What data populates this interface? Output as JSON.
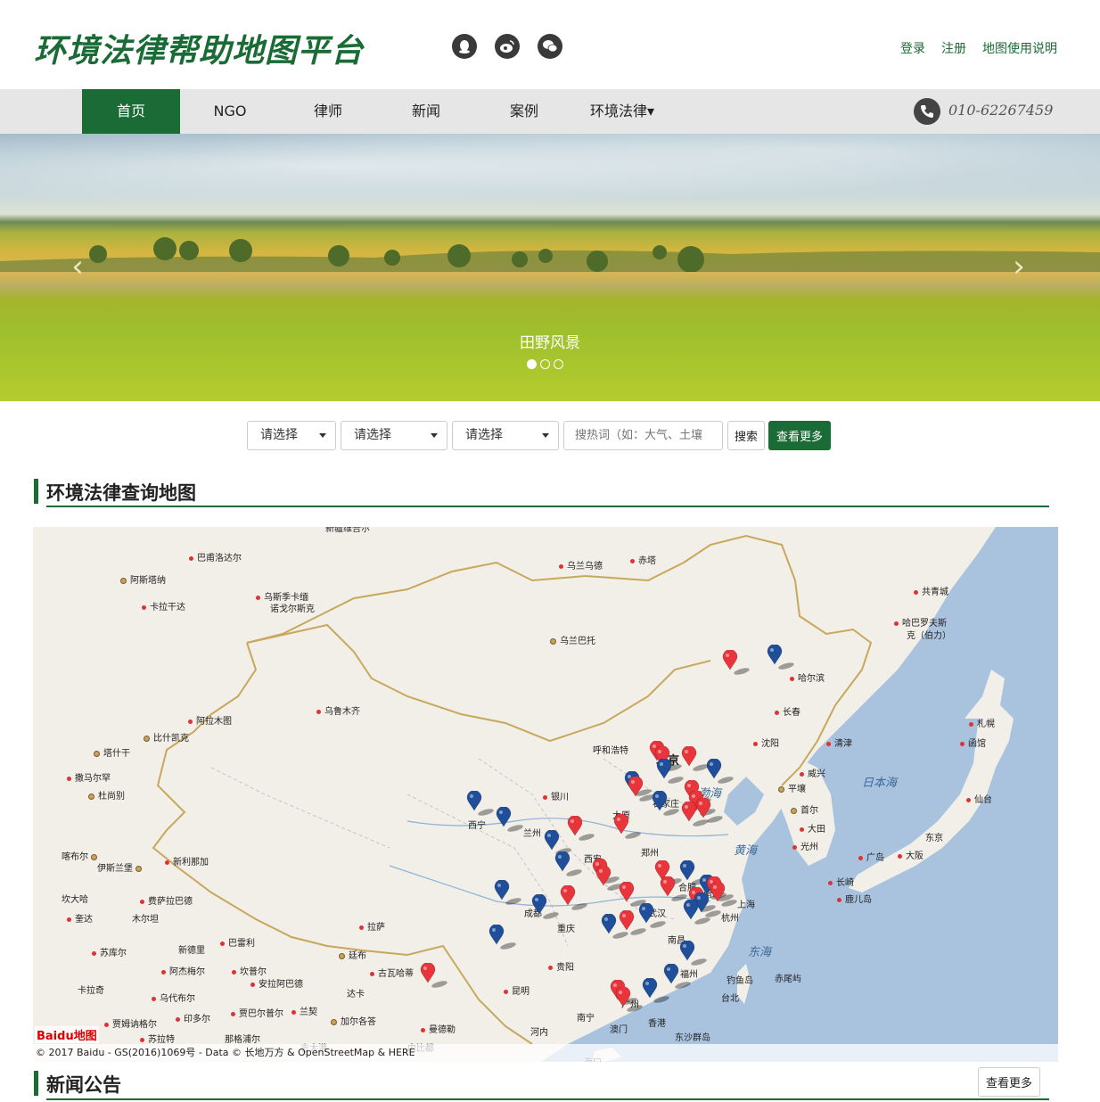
{
  "header": {
    "logo": "环境法律帮助地图平台",
    "links": [
      "登录",
      "注册",
      "地图使用说明"
    ]
  },
  "nav": {
    "items": [
      "首页",
      "NGO",
      "律师",
      "新闻",
      "案例",
      "环境法律▾"
    ],
    "phone": "010-62267459"
  },
  "banner": {
    "caption": "田野风景",
    "active_slide": 1,
    "slide_count": 3
  },
  "search": {
    "select1": "请选择",
    "select2": "请选择",
    "select3": "请选择",
    "placeholder": "搜热词（如：大气、土壤",
    "search_btn": "搜索",
    "more_btn": "查看更多"
  },
  "map_section": {
    "title": "环境法律查询地图",
    "labels": {
      "l01": "新疆维吾尔",
      "l02": "巴甫洛达尔",
      "l03": "阿斯塔纳",
      "l04": "卡拉干达",
      "l05": "乌斯季卡缅",
      "l06": "诺戈尔斯克",
      "l07": "乌兰乌德",
      "l08": "赤塔",
      "l09": "乌兰巴托",
      "l10": "共青城",
      "l11": "哈巴罗夫斯",
      "l12": "克（伯力）",
      "l13": "哈尔滨",
      "l14": "长春",
      "l15": "乌鲁木齐",
      "l16": "阿拉木图",
      "l17": "比什凯克",
      "l18": "塔什干",
      "l19": "撒马尔罕",
      "l20": "杜尚别",
      "l21": "呼和浩特",
      "l22": "北京",
      "l23": "沈阳",
      "l24": "清津",
      "l25": "札幌",
      "l26": "函馆",
      "l27": "威兴",
      "l28": "平壤",
      "l29": "首尔",
      "l30": "大田",
      "l31": "光州",
      "l32": "日本海",
      "l33": "仙台",
      "l34": "东京",
      "l35": "广岛",
      "l36": "大阪",
      "l37": "长崎",
      "l38": "鹿儿岛",
      "l39": "银川",
      "l40": "太原",
      "l41": "石家庄",
      "l42": "渤海",
      "l43": "西宁",
      "l44": "兰州",
      "l45": "西安",
      "l46": "郑州",
      "l47": "黄海",
      "l48": "喀布尔",
      "l49": "伊斯兰堡",
      "l50": "新利那加",
      "l51": "坎大哈",
      "l52": "奎达",
      "l53": "费萨拉巴德",
      "l54": "木尔坦",
      "l55": "苏库尔",
      "l56": "新德里",
      "l57": "巴雷利",
      "l58": "拉萨",
      "l59": "成都",
      "l60": "重庆",
      "l61": "合肥",
      "l62": "南京",
      "l63": "上海",
      "l64": "武汉",
      "l65": "杭州",
      "l66": "南昌",
      "l67": "东海",
      "l68": "廷布",
      "l69": "阿杰梅尔",
      "l70": "坎普尔",
      "l71": "安拉阿巴德",
      "l72": "古瓦哈蒂",
      "l73": "贵阳",
      "l74": "福州",
      "l75": "钓鱼岛",
      "l76": "赤尾屿",
      "l77": "卡拉奇",
      "l78": "乌代布尔",
      "l79": "达卡",
      "l80": "昆明",
      "l81": "台北",
      "l82": "广州",
      "l83": "贾姆讷格尔",
      "l84": "印多尔",
      "l85": "贾巴尔普尔",
      "l86": "兰契",
      "l87": "加尔各答",
      "l88": "南宁",
      "l89": "澳门",
      "l90": "香港",
      "l91": "苏拉特",
      "l92": "那格浦尔",
      "l93": "吉大港",
      "l94": "曼德勒",
      "l95": "河内",
      "l96": "东沙群岛",
      "l97": "内比都",
      "l98": "海口"
    },
    "baidu_logo": "Baidu地图",
    "copyright": "© 2017 Baidu - GS(2016)1069号 - Data © 长地万方 & OpenStreetMap & HERE"
  },
  "news_section": {
    "title": "新闻公告",
    "more_btn": "查看更多"
  },
  "colors": {
    "brand_green": "#1a6b35",
    "pin_red": "#e8343a",
    "pin_blue": "#1f4f9a",
    "sea": "#a9c3df",
    "land": "#f2efe8"
  },
  "icons": [
    "qq-icon",
    "weibo-icon",
    "wechat-icon",
    "phone-icon",
    "chevron-left-icon",
    "chevron-right-icon",
    "map-pin-icon"
  ]
}
